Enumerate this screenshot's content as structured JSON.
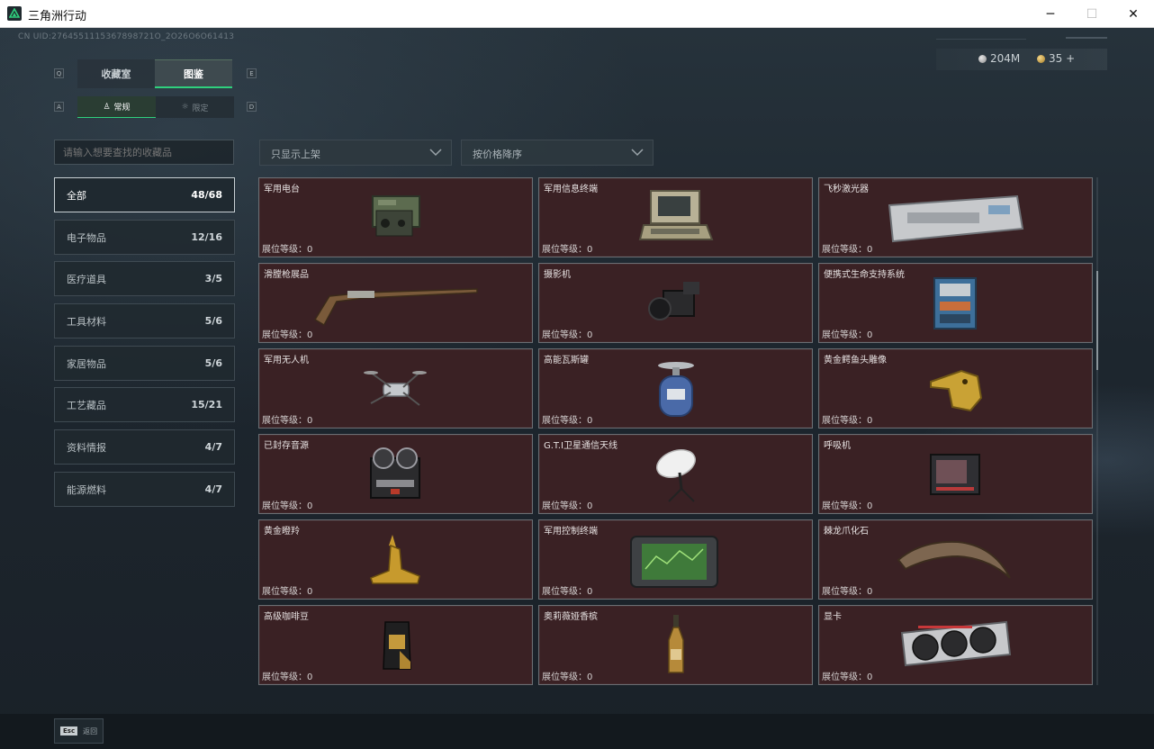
{
  "window": {
    "title": "三角洲行动",
    "min": "─",
    "max": "☐",
    "close": "✕"
  },
  "uid": "CN UID:2764551115367898721O_2O26O6O61413",
  "currency": {
    "silver": "204M",
    "gold": "35 +"
  },
  "keys": {
    "q": "Q",
    "e": "E",
    "a": "A",
    "d": "D"
  },
  "tabs": [
    "收藏室",
    "图鉴"
  ],
  "subtabs": [
    "常规",
    "限定"
  ],
  "search": {
    "placeholder": "请输入想要查找的收藏品"
  },
  "filters": [
    "只显示上架",
    "按价格降序"
  ],
  "categories": [
    {
      "label": "全部",
      "count": "48/68"
    },
    {
      "label": "电子物品",
      "count": "12/16"
    },
    {
      "label": "医疗道具",
      "count": "3/5"
    },
    {
      "label": "工具材料",
      "count": "5/6"
    },
    {
      "label": "家居物品",
      "count": "5/6"
    },
    {
      "label": "工艺藏品",
      "count": "15/21"
    },
    {
      "label": "资料情报",
      "count": "4/7"
    },
    {
      "label": "能源燃料",
      "count": "4/7"
    }
  ],
  "items": [
    {
      "name": "军用电台",
      "level": "展位等级：0",
      "icon": "radio-icon"
    },
    {
      "name": "军用信息终端",
      "level": "展位等级：0",
      "icon": "laptop-terminal-icon"
    },
    {
      "name": "飞秒激光器",
      "level": "展位等级：0",
      "icon": "laser-box-icon"
    },
    {
      "name": "滑膛枪展品",
      "level": "展位等级：0",
      "icon": "musket-icon"
    },
    {
      "name": "摄影机",
      "level": "展位等级：0",
      "icon": "camera-icon"
    },
    {
      "name": "便携式生命支持系统",
      "level": "展位等级：0",
      "icon": "life-support-icon"
    },
    {
      "name": "军用无人机",
      "level": "展位等级：0",
      "icon": "drone-icon"
    },
    {
      "name": "高能瓦斯罐",
      "level": "展位等级：0",
      "icon": "gas-tank-icon"
    },
    {
      "name": "黄金鳄鱼头雕像",
      "level": "展位等级：0",
      "icon": "gold-croc-icon"
    },
    {
      "name": "已封存音源",
      "level": "展位等级：0",
      "icon": "reel-recorder-icon"
    },
    {
      "name": "G.T.I卫星通信天线",
      "level": "展位等级：0",
      "icon": "satellite-dish-icon"
    },
    {
      "name": "呼吸机",
      "level": "展位等级：0",
      "icon": "ventilator-icon"
    },
    {
      "name": "黄金瞪羚",
      "level": "展位等级：0",
      "icon": "gold-gazelle-icon"
    },
    {
      "name": "军用控制终端",
      "level": "展位等级：0",
      "icon": "control-terminal-icon"
    },
    {
      "name": "棘龙爪化石",
      "level": "展位等级：0",
      "icon": "claw-fossil-icon"
    },
    {
      "name": "高级咖啡豆",
      "level": "展位等级：0",
      "icon": "coffee-bag-icon"
    },
    {
      "name": "奥莉薇娅香槟",
      "level": "展位等级：0",
      "icon": "champagne-icon"
    },
    {
      "name": "显卡",
      "level": "展位等级：0",
      "icon": "gpu-icon"
    }
  ],
  "back": {
    "key": "Esc",
    "label": "返回"
  },
  "colors": {
    "accent": "#2fd07d",
    "card": "#3a2124"
  }
}
